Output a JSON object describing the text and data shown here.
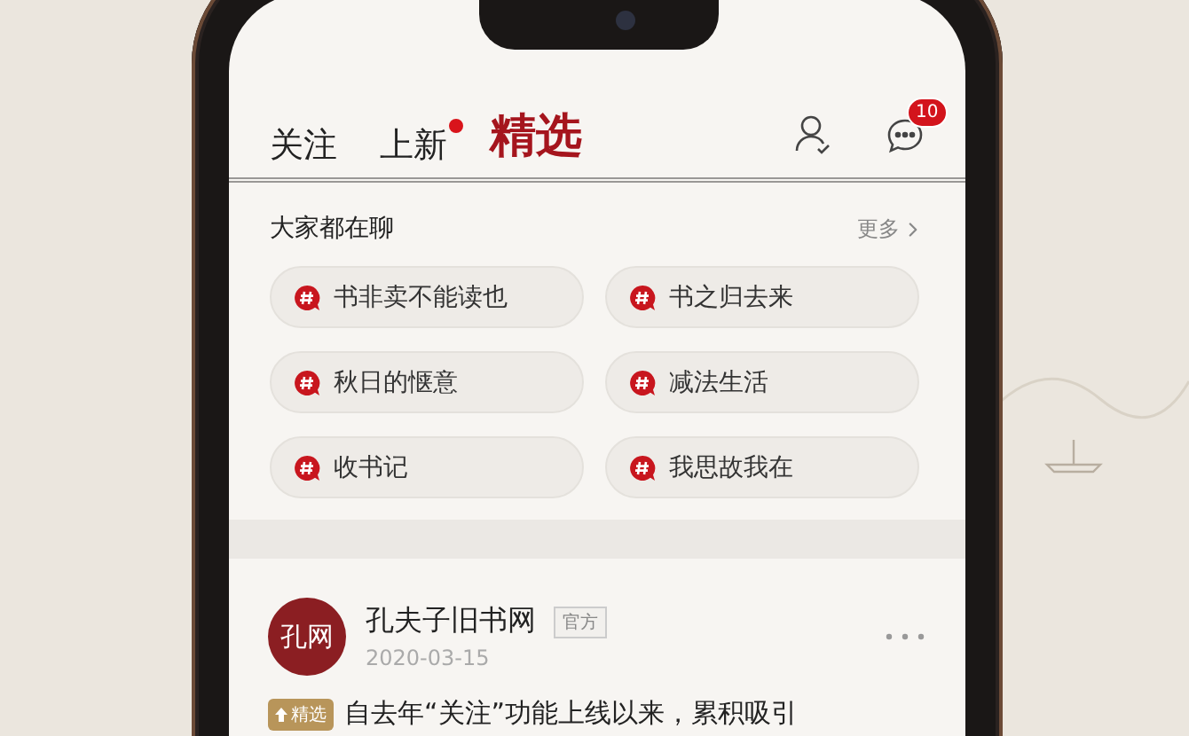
{
  "tabs": [
    {
      "label": "关注",
      "selected": false,
      "dot": false
    },
    {
      "label": "上新",
      "selected": false,
      "dot": true
    },
    {
      "label": "精选",
      "selected": true,
      "dot": false
    }
  ],
  "messages_badge": "10",
  "topics": {
    "title": "大家都在聊",
    "more": "更多",
    "items": [
      {
        "label": "书非卖不能读也"
      },
      {
        "label": "书之归去来"
      },
      {
        "label": "秋日的惬意"
      },
      {
        "label": "减法生活"
      },
      {
        "label": "收书记"
      },
      {
        "label": "我思故我在"
      }
    ]
  },
  "post": {
    "avatar_text": "孔网",
    "author": "孔夫子旧书网",
    "tag": "官方",
    "date": "2020-03-15",
    "badge": "精选",
    "text": "自去年“关注”功能上线以来，累积吸引"
  }
}
